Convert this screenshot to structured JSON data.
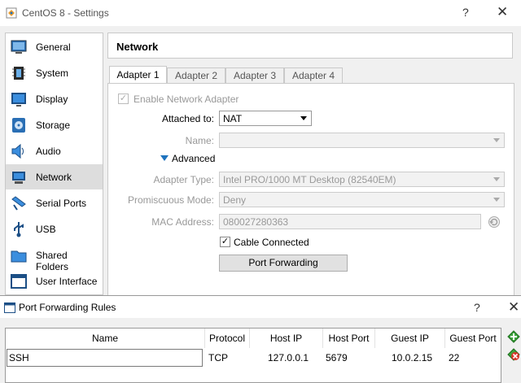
{
  "window": {
    "title": "CentOS 8 - Settings",
    "help": "?",
    "close": "✕"
  },
  "sidebar": {
    "items": [
      {
        "label": "General"
      },
      {
        "label": "System"
      },
      {
        "label": "Display"
      },
      {
        "label": "Storage"
      },
      {
        "label": "Audio"
      },
      {
        "label": "Network"
      },
      {
        "label": "Serial Ports"
      },
      {
        "label": "USB"
      },
      {
        "label": "Shared Folders"
      },
      {
        "label": "User Interface"
      }
    ]
  },
  "panel": {
    "title": "Network",
    "tabs": [
      "Adapter 1",
      "Adapter 2",
      "Adapter 3",
      "Adapter 4"
    ],
    "enable_label": "Enable Network Adapter",
    "enable_mark": "✓",
    "attached_label": "Attached to:",
    "attached_value": "NAT",
    "name_label": "Name:",
    "name_value": "",
    "advanced_label": "Advanced",
    "adapter_type_label": "Adapter Type:",
    "adapter_type_value": "Intel PRO/1000 MT Desktop (82540EM)",
    "promisc_label": "Promiscuous Mode:",
    "promisc_value": "Deny",
    "mac_label": "MAC Address:",
    "mac_value": "080027280363",
    "cable_label": "Cable Connected",
    "cable_mark": "✓",
    "port_forwarding_label": "Port Forwarding"
  },
  "dialog": {
    "title": "Port Forwarding Rules",
    "help": "?",
    "close": "✕",
    "columns": [
      "Name",
      "Protocol",
      "Host IP",
      "Host Port",
      "Guest IP",
      "Guest Port"
    ],
    "rows": [
      {
        "name": "SSH",
        "protocol": "TCP",
        "host_ip": "127.0.0.1",
        "host_port": "5679",
        "guest_ip": "10.0.2.15",
        "guest_port": "22"
      }
    ]
  },
  "colors": {
    "selected_item": "#dddddd",
    "accent": "#1e73be",
    "add_green": "#3da33d",
    "remove_red": "#d9352b"
  }
}
